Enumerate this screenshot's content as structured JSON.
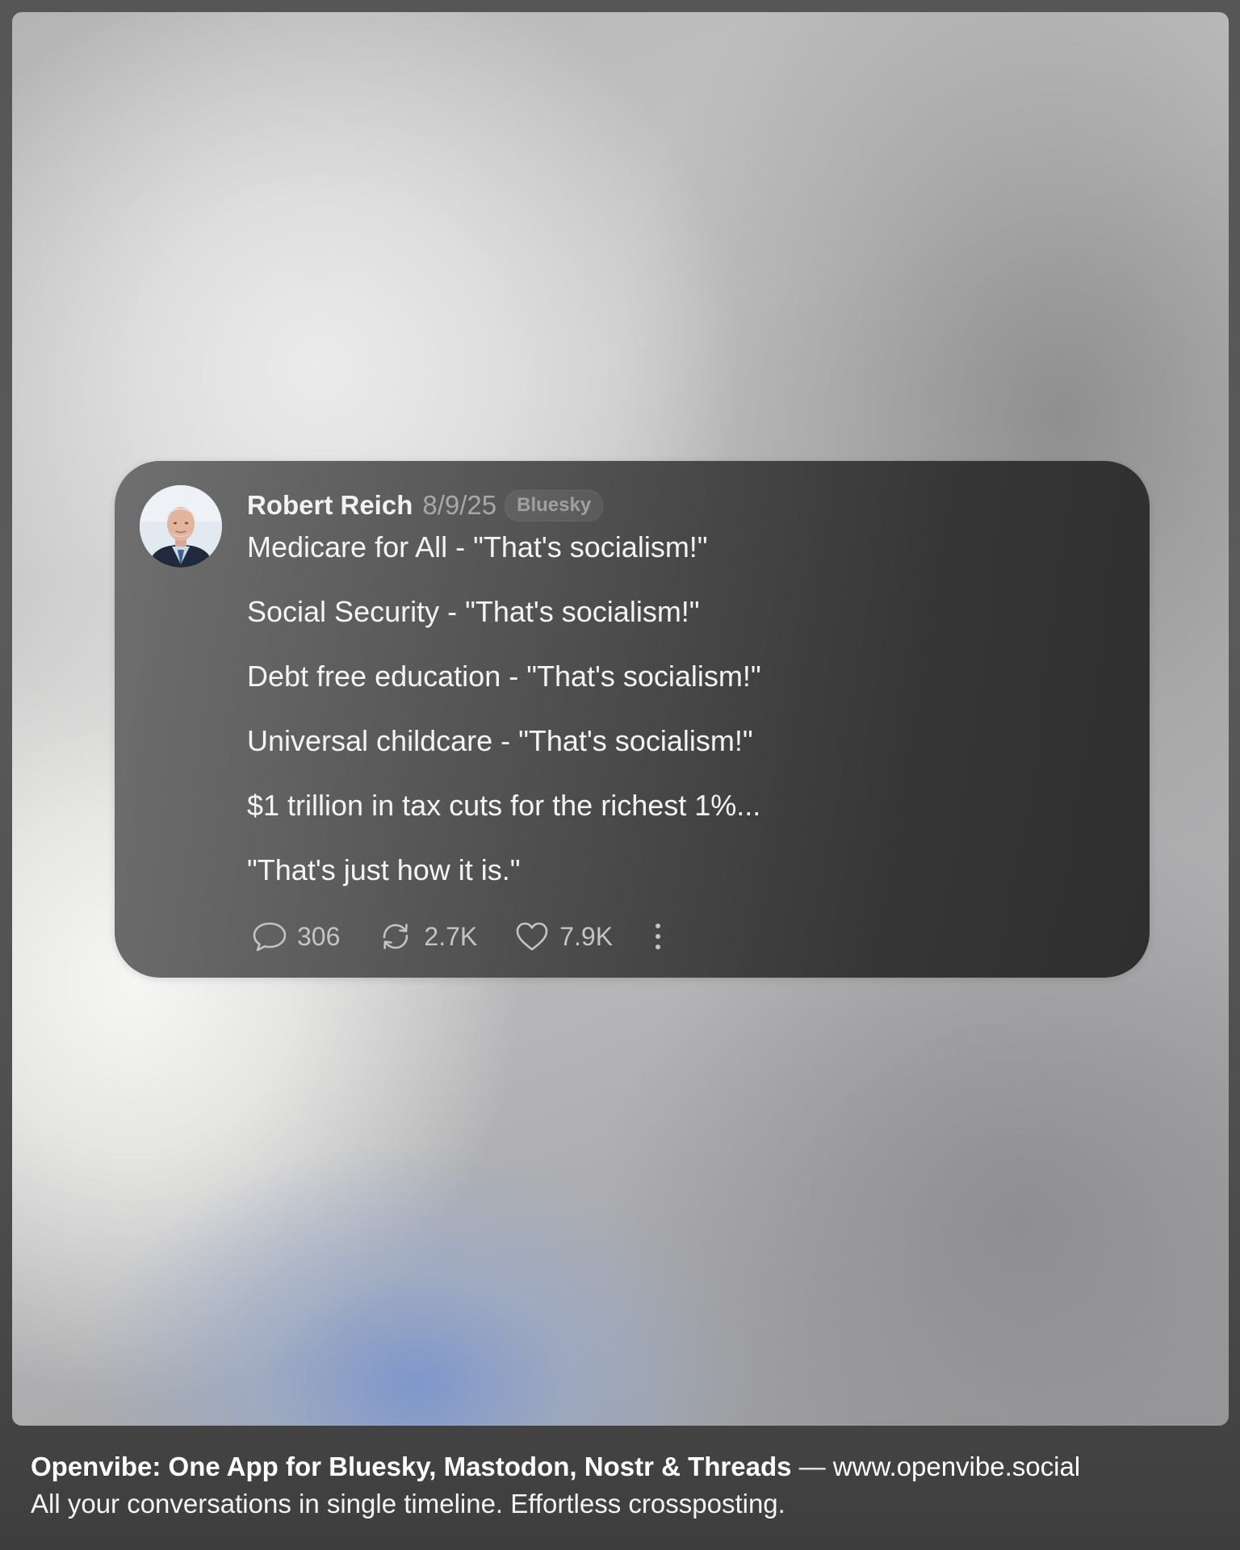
{
  "post": {
    "author": "Robert Reich",
    "date": "8/9/25",
    "platform": "Bluesky",
    "lines": [
      "Medicare for All - \"That's socialism!\"",
      "Social Security - \"That's socialism!\"",
      "Debt free education - \"That's socialism!\"",
      "Universal childcare - \"That's socialism!\"",
      "$1 trillion in tax cuts for the richest 1%...",
      "\"That's just how it is.\""
    ],
    "stats": {
      "replies": "306",
      "reposts": "2.7K",
      "likes": "7.9K"
    },
    "icons": {
      "reply": "speech-bubble-icon",
      "repost": "repost-arrows-icon",
      "like": "heart-icon",
      "more": "vertical-dots-icon"
    }
  },
  "footer": {
    "title": "Openvibe: One App for Bluesky, Mastodon, Nostr & Threads",
    "separator": " — ",
    "url": "www.openvibe.social",
    "tagline": "All your conversations in single timeline. Effortless crossposting."
  },
  "colors": {
    "card_background": "#3a3a3a",
    "text_primary": "#f4f4f4",
    "text_muted": "#a8a8a8",
    "accent_glow": "#8a9ecb"
  }
}
